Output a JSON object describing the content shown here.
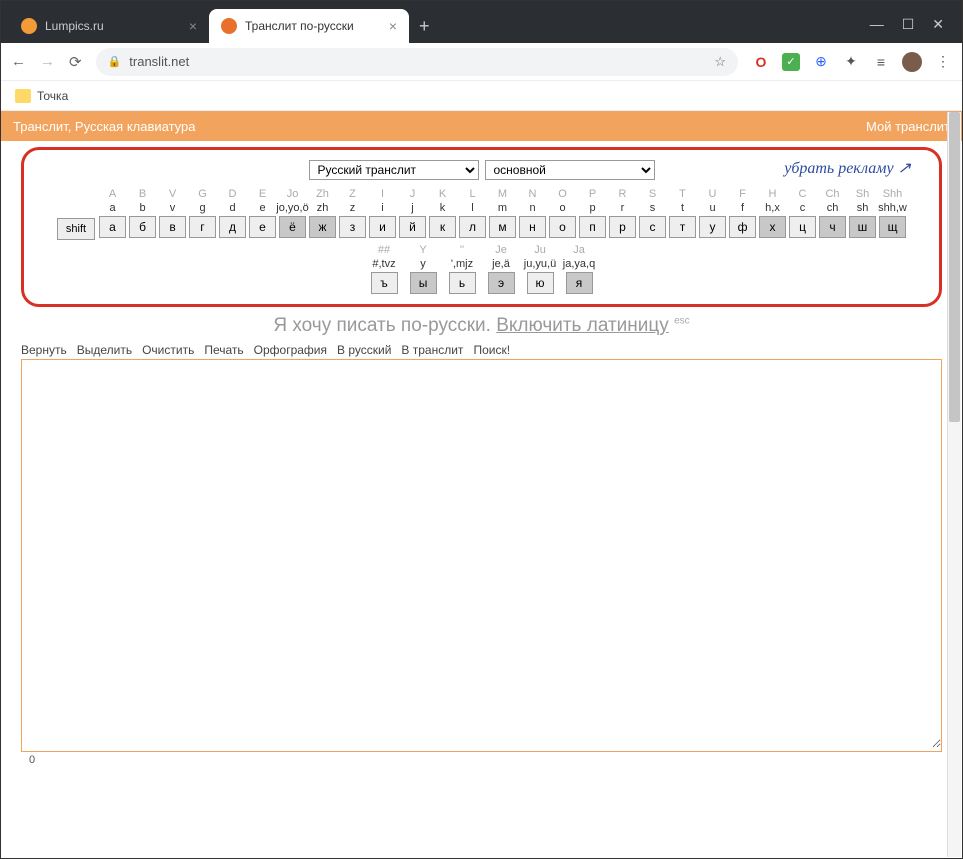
{
  "browser": {
    "tabs": [
      {
        "title": "Lumpics.ru",
        "active": false,
        "iconColor": "#f29b38"
      },
      {
        "title": "Транслит по-русски",
        "active": true,
        "iconColor": "#e8702a"
      }
    ],
    "url": "translit.net",
    "bookmark": "Точка"
  },
  "header": {
    "left": "Транслит, Русская клавиатура",
    "right": "Мой транслит"
  },
  "selectors": {
    "lang": "Русский транслит",
    "mode": "основной",
    "adRemove": "убрать рекламу ↗"
  },
  "keyboard": {
    "shift": "shift",
    "row1": [
      {
        "u": "A",
        "l": "a",
        "k": "а",
        "d": false
      },
      {
        "u": "B",
        "l": "b",
        "k": "б",
        "d": false
      },
      {
        "u": "V",
        "l": "v",
        "k": "в",
        "d": false
      },
      {
        "u": "G",
        "l": "g",
        "k": "г",
        "d": false
      },
      {
        "u": "D",
        "l": "d",
        "k": "д",
        "d": false
      },
      {
        "u": "E",
        "l": "e",
        "k": "е",
        "d": false
      },
      {
        "u": "Jo",
        "l": "jo,yo,ö",
        "k": "ё",
        "d": true
      },
      {
        "u": "Zh",
        "l": "zh",
        "k": "ж",
        "d": true
      },
      {
        "u": "Z",
        "l": "z",
        "k": "з",
        "d": false
      },
      {
        "u": "I",
        "l": "i",
        "k": "и",
        "d": false
      },
      {
        "u": "J",
        "l": "j",
        "k": "й",
        "d": false
      },
      {
        "u": "K",
        "l": "k",
        "k": "к",
        "d": false
      },
      {
        "u": "L",
        "l": "l",
        "k": "л",
        "d": false
      },
      {
        "u": "M",
        "l": "m",
        "k": "м",
        "d": false
      },
      {
        "u": "N",
        "l": "n",
        "k": "н",
        "d": false
      },
      {
        "u": "O",
        "l": "o",
        "k": "о",
        "d": false
      },
      {
        "u": "P",
        "l": "p",
        "k": "п",
        "d": false
      },
      {
        "u": "R",
        "l": "r",
        "k": "р",
        "d": false
      },
      {
        "u": "S",
        "l": "s",
        "k": "с",
        "d": false
      },
      {
        "u": "T",
        "l": "t",
        "k": "т",
        "d": false
      },
      {
        "u": "U",
        "l": "u",
        "k": "у",
        "d": false
      },
      {
        "u": "F",
        "l": "f",
        "k": "ф",
        "d": false
      },
      {
        "u": "H",
        "l": "h,x",
        "k": "х",
        "d": true
      },
      {
        "u": "C",
        "l": "c",
        "k": "ц",
        "d": false
      },
      {
        "u": "Ch",
        "l": "ch",
        "k": "ч",
        "d": true
      },
      {
        "u": "Sh",
        "l": "sh",
        "k": "ш",
        "d": true
      },
      {
        "u": "Shh",
        "l": "shh,w",
        "k": "щ",
        "d": true
      }
    ],
    "row2": [
      {
        "u": "##",
        "l": "#,tvz",
        "k": "ъ",
        "d": false
      },
      {
        "u": "Y",
        "l": "y",
        "k": "ы",
        "d": true
      },
      {
        "u": "''",
        "l": "',mjz",
        "k": "ь",
        "d": false
      },
      {
        "u": "Je",
        "l": "je,ä",
        "k": "э",
        "d": true
      },
      {
        "u": "Ju",
        "l": "ju,yu,ü",
        "k": "ю",
        "d": false
      },
      {
        "u": "Ja",
        "l": "ja,ya,q",
        "k": "я",
        "d": true
      }
    ]
  },
  "prompt": {
    "text1": "Я хочу писать по-русски. ",
    "link": "Включить латиницу",
    "esc": "esc"
  },
  "toolbar": [
    "Вернуть",
    "Выделить",
    "Очистить",
    "Печать",
    "Орфография",
    "В русский",
    "В транслит",
    "Поиск!"
  ],
  "counter": "0"
}
